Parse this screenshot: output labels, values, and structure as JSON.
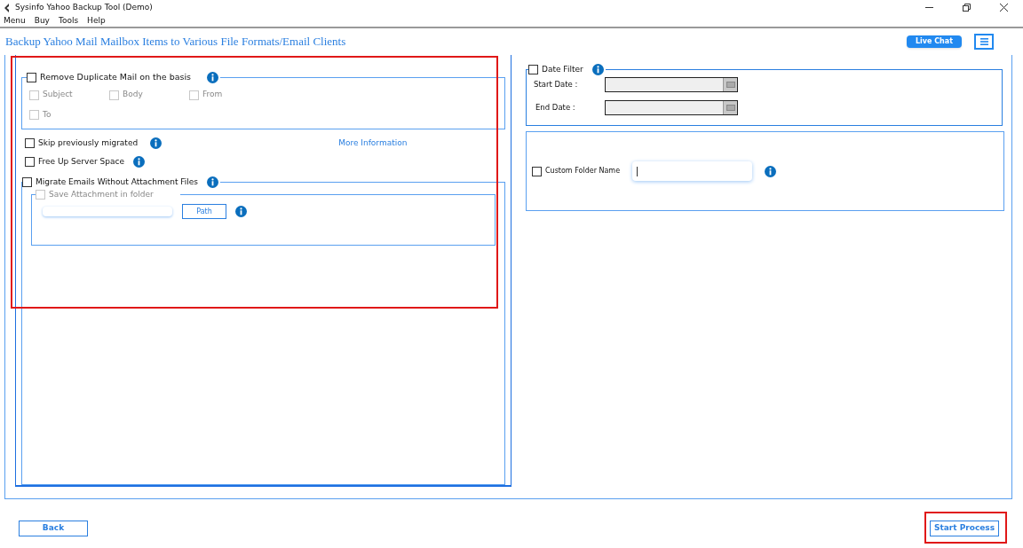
{
  "window": {
    "title": "Sysinfo Yahoo Backup Tool (Demo)"
  },
  "menu": [
    "Menu",
    "Buy",
    "Tools",
    "Help"
  ],
  "heading": "Backup Yahoo Mail Mailbox Items to Various File Formats/Email Clients",
  "live_chat": "Live Chat",
  "duplicate": {
    "label": "Remove Duplicate Mail on the basis",
    "checked": false,
    "options": [
      {
        "label": "Subject",
        "checked": false,
        "disabled": true
      },
      {
        "label": "Body",
        "checked": false,
        "disabled": true
      },
      {
        "label": "From",
        "checked": false,
        "disabled": true
      },
      {
        "label": "To",
        "checked": false,
        "disabled": true
      }
    ]
  },
  "skip": {
    "label": "Skip previously migrated",
    "checked": false
  },
  "more_info": "More Information",
  "free_up": {
    "label": "Free Up Server Space",
    "checked": false
  },
  "migrate": {
    "label": "Migrate Emails Without Attachment Files",
    "checked": false
  },
  "save_attachment": {
    "label": "Save Attachment in folder",
    "checked": false,
    "disabled": true
  },
  "path_button": "Path",
  "date_filter": {
    "label": "Date Filter",
    "checked": false,
    "start_label": "Start Date :",
    "end_label": "End Date :"
  },
  "custom_folder": {
    "label": "Custom Folder Name",
    "checked": false
  },
  "footer": {
    "back": "Back",
    "start": "Start Process"
  }
}
